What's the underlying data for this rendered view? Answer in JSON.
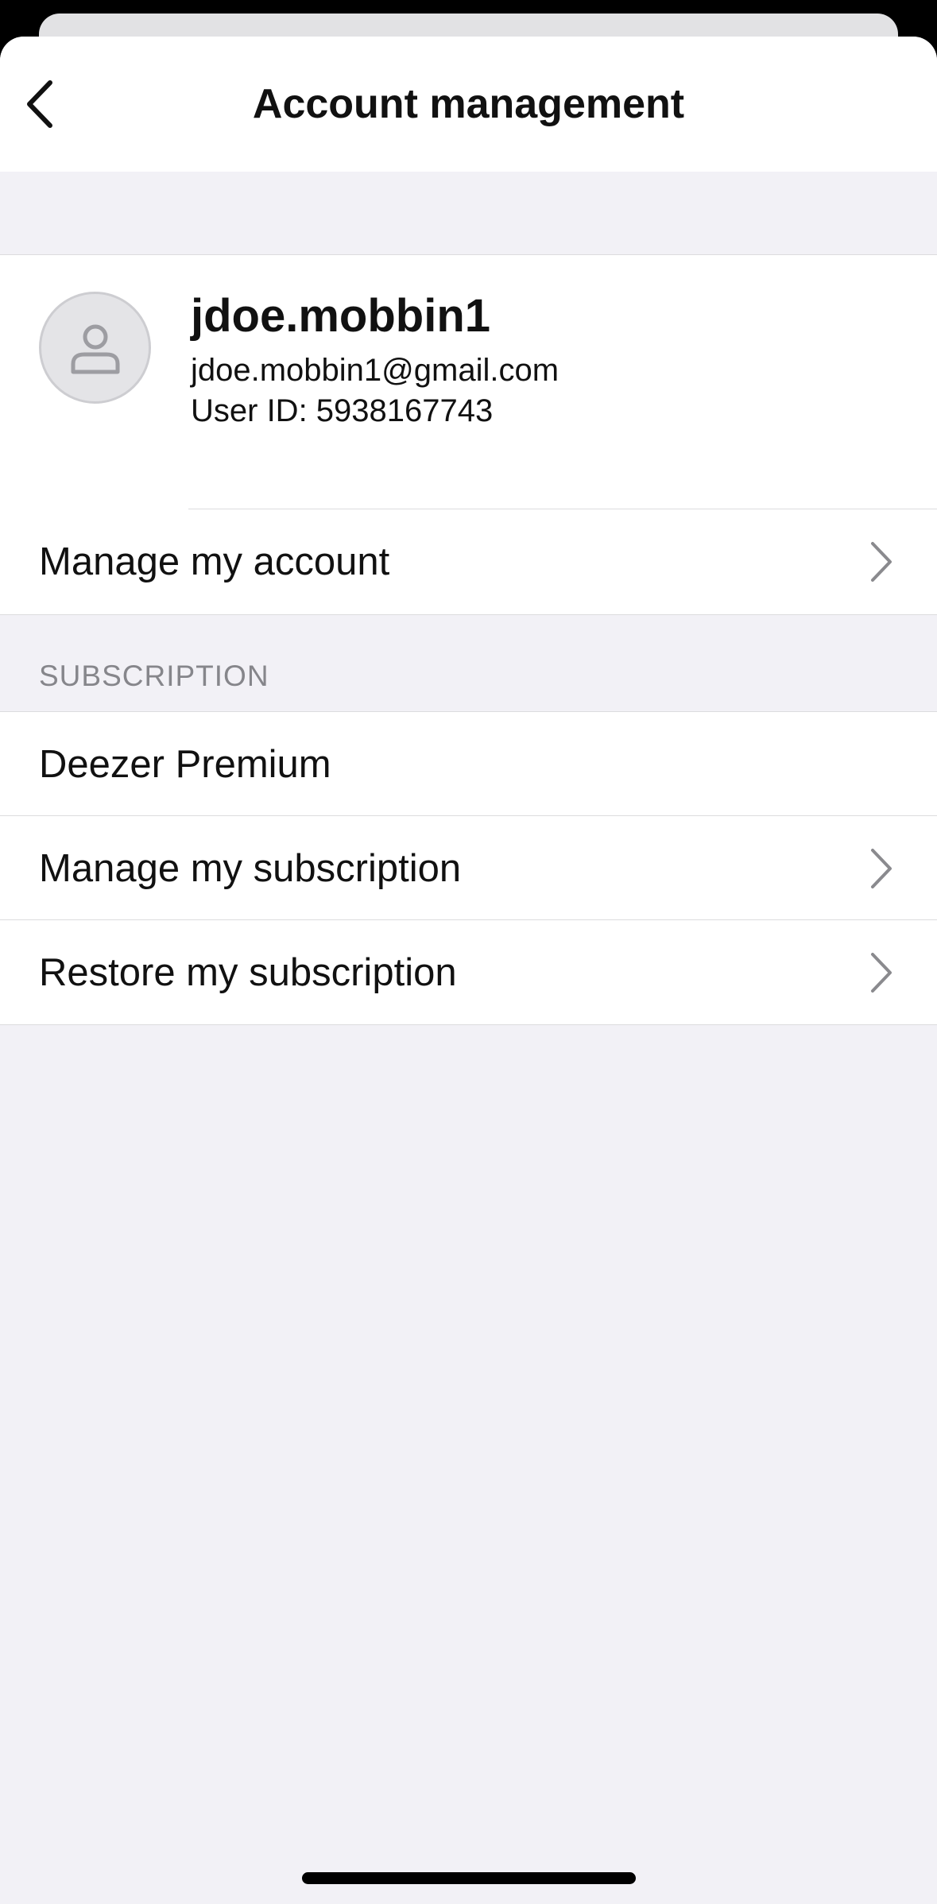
{
  "nav": {
    "title": "Account management",
    "back_icon": "chevron-left-icon"
  },
  "profile": {
    "avatar_icon": "person-icon",
    "username": "jdoe.mobbin1",
    "email": "jdoe.mobbin1@gmail.com",
    "user_id": "User ID: 5938167743",
    "manage_account_label": "Manage my account"
  },
  "subscription": {
    "header": "SUBSCRIPTION",
    "plan": "Deezer Premium",
    "manage_label": "Manage my subscription",
    "restore_label": "Restore my subscription"
  },
  "colors": {
    "sheet_background": "#f2f1f6",
    "card_background": "#ffffff",
    "section_header_text": "#86868b",
    "chevron": "#8a8a8e"
  }
}
